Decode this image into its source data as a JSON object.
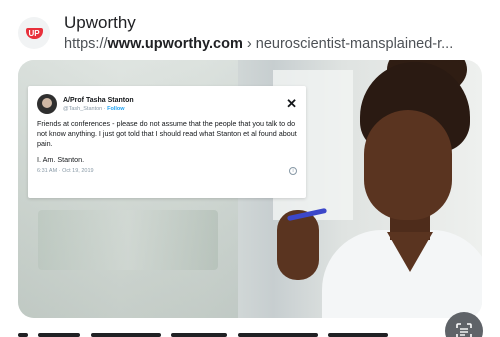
{
  "result": {
    "site_name": "Upworthy",
    "url_prefix": "https://",
    "url_domain": "www.upworthy.com",
    "url_path": " › neuroscientist-mansplained-r...",
    "site_icon": "upworthy-logo",
    "site_logo_text": "UP",
    "brand_color": "#e8303b"
  },
  "tweet": {
    "author_name": "A/Prof Tasha Stanton",
    "author_handle": "@Tash_Stanton",
    "follow_label": "Follow",
    "body": "Friends at conferences - please do not assume that the people that you talk to do not know anything. I just got told that I should read what  Stanton et al found about pain.",
    "signoff": "I. Am. Stanton.",
    "timestamp": "6:31 AM · Oct 19, 2019",
    "close_icon": "x-logo-icon",
    "info_icon": "info-icon",
    "link_color": "#1da1f2"
  },
  "lens": {
    "icon": "visual-search-icon"
  }
}
